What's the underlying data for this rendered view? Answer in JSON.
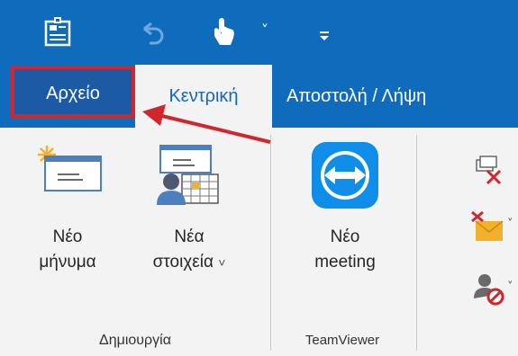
{
  "colors": {
    "accent_blue": "#0f6cbd",
    "file_tab_bg": "#1d5aa6",
    "highlight_red": "#d0272c",
    "home_tab_text": "#1565c0",
    "ribbon_bg": "#f3f3f3"
  },
  "quick_access": {
    "icons": [
      "send-receive-all-folders-icon",
      "undo-icon",
      "touch-mouse-mode-icon",
      "customize-toolbar-icon"
    ],
    "dropdown_glyph": "˅"
  },
  "tabs": {
    "file": "Αρχείο",
    "home": "Κεντρική",
    "send_receive": "Αποστολή / Λήψη"
  },
  "ribbon": {
    "new_group": {
      "label": "Δημιουργία",
      "new_email": {
        "line1": "Νέο",
        "line2": "μήνυμα"
      },
      "new_items": {
        "line1": "Νέα",
        "line2": "στοιχεία"
      }
    },
    "teamviewer_group": {
      "label": "TeamViewer",
      "new_meeting": {
        "line1": "Νέο",
        "line2": "meeting"
      }
    },
    "delete_group": {
      "icons": [
        "ignore-icon",
        "clean-up-icon",
        "junk-icon"
      ]
    }
  }
}
